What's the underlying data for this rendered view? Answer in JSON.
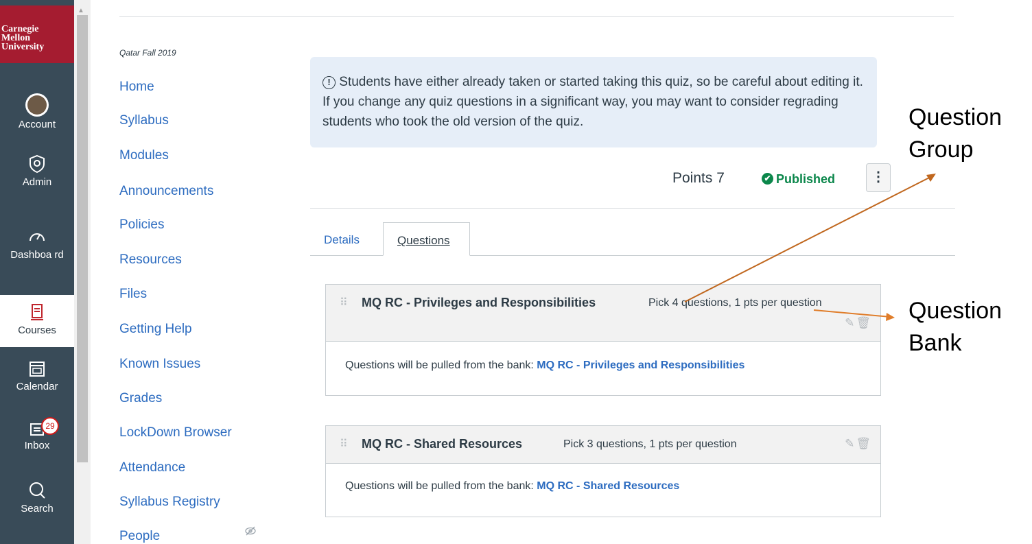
{
  "brand": {
    "lines": [
      "Carnegie",
      "Mellon",
      "University"
    ]
  },
  "global_nav": {
    "items": [
      {
        "label": "Account",
        "icon": "avatar-icon"
      },
      {
        "label": "Admin",
        "icon": "shield-icon"
      },
      {
        "label": "Dashboa rd",
        "icon": "dashboard-icon"
      },
      {
        "label": "Courses",
        "icon": "book-icon"
      },
      {
        "label": "Calendar",
        "icon": "calendar-icon"
      },
      {
        "label": "Inbox",
        "icon": "inbox-icon",
        "badge": "29"
      },
      {
        "label": "Search",
        "icon": "search-icon"
      }
    ]
  },
  "course": {
    "term": "Qatar Fall 2019",
    "nav": [
      "Home",
      "Syllabus",
      "Modules",
      "Announcements",
      "Policies",
      "Resources",
      "Files",
      "Getting Help",
      "Known Issues",
      "Grades",
      "LockDown Browser",
      "Attendance",
      "Syllabus Registry",
      "People"
    ]
  },
  "alert": {
    "icon": "alert-icon",
    "text": "Students have either already taken or started taking this quiz, so be careful about editing it. If you change any quiz questions in a significant way, you may want to consider regrading students who took the old version of the quiz."
  },
  "quiz": {
    "points_label": "Points 7",
    "status": "Published",
    "colors": {
      "published": "#0b874b",
      "link": "#2d6cc0",
      "brand": "#a51c30"
    }
  },
  "tabs": [
    "Details",
    "Questions"
  ],
  "groups": [
    {
      "title": "MQ RC - Privileges and Responsibilities",
      "pick": "Pick 4 questions, 1 pts per question",
      "bank_prefix": "Questions will be pulled from the bank:",
      "bank_name": "MQ RC - Privileges and Responsibilities"
    },
    {
      "title": "MQ RC - Shared Resources",
      "pick": "Pick 3 questions, 1 pts per question",
      "bank_prefix": "Questions will be pulled from the bank:",
      "bank_name": "MQ RC - Shared Resources"
    }
  ],
  "annotations": {
    "group_label": [
      "Question",
      "Group"
    ],
    "bank_label": [
      "Question",
      "Bank"
    ]
  }
}
